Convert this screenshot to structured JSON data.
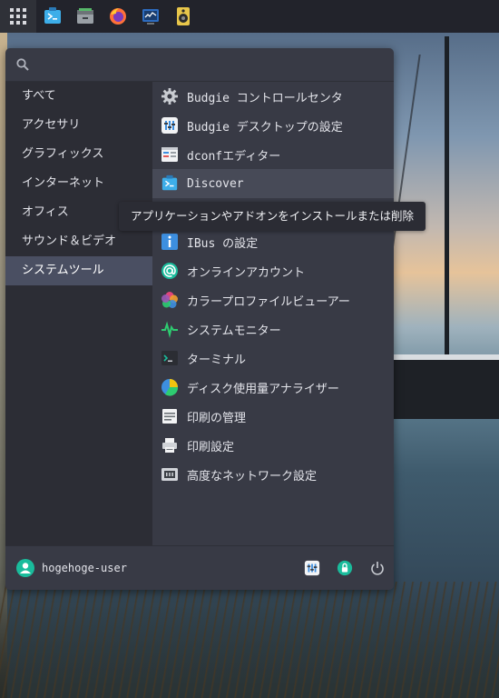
{
  "panel": {
    "app_menu_icon": "grid-icon",
    "taskbar": [
      "discover-icon",
      "file-manager-icon",
      "firefox-icon",
      "system-monitor-icon",
      "speaker-icon"
    ]
  },
  "search": {
    "placeholder": "",
    "value": ""
  },
  "categories": [
    {
      "label": "すべて"
    },
    {
      "label": "アクセサリ"
    },
    {
      "label": "グラフィックス"
    },
    {
      "label": "インターネット"
    },
    {
      "label": "オフィス"
    },
    {
      "label": "サウンド＆ビデオ"
    },
    {
      "label": "システムツール",
      "active": true
    }
  ],
  "apps": [
    {
      "label": "Budgie コントロールセンタ",
      "icon": "gear-icon"
    },
    {
      "label": "Budgie デスクトップの設定",
      "icon": "budgie-settings-icon"
    },
    {
      "label": "dconfエディター",
      "icon": "dconf-icon"
    },
    {
      "label": "Discover",
      "icon": "discover-icon",
      "hover": true
    },
    {
      "label": "IBus の設定",
      "icon": "info-icon"
    },
    {
      "label": "オンラインアカウント",
      "icon": "at-sign-icon"
    },
    {
      "label": "カラープロファイルビューアー",
      "icon": "color-profile-icon"
    },
    {
      "label": "システムモニター",
      "icon": "system-monitor-icon"
    },
    {
      "label": "ターミナル",
      "icon": "terminal-icon"
    },
    {
      "label": "ディスク使用量アナライザー",
      "icon": "disk-usage-icon"
    },
    {
      "label": "印刷の管理",
      "icon": "print-manager-icon"
    },
    {
      "label": "印刷設定",
      "icon": "printer-icon"
    },
    {
      "label": "高度なネットワーク設定",
      "icon": "network-icon"
    }
  ],
  "tooltip": "アプリケーションやアドオンをインストールまたは削除",
  "footer": {
    "username": "hogehoge-user",
    "buttons": [
      "settings-icon",
      "lock-icon",
      "power-icon"
    ]
  },
  "colors": {
    "panel_bg": "#22232b",
    "menu_bg": "#383a45",
    "category_bg": "#2c2d35",
    "active_category": "#4a4f62",
    "hover_row": "#474a57",
    "accent_teal": "#1abc9c",
    "accent_blue": "#3d8fe0"
  }
}
